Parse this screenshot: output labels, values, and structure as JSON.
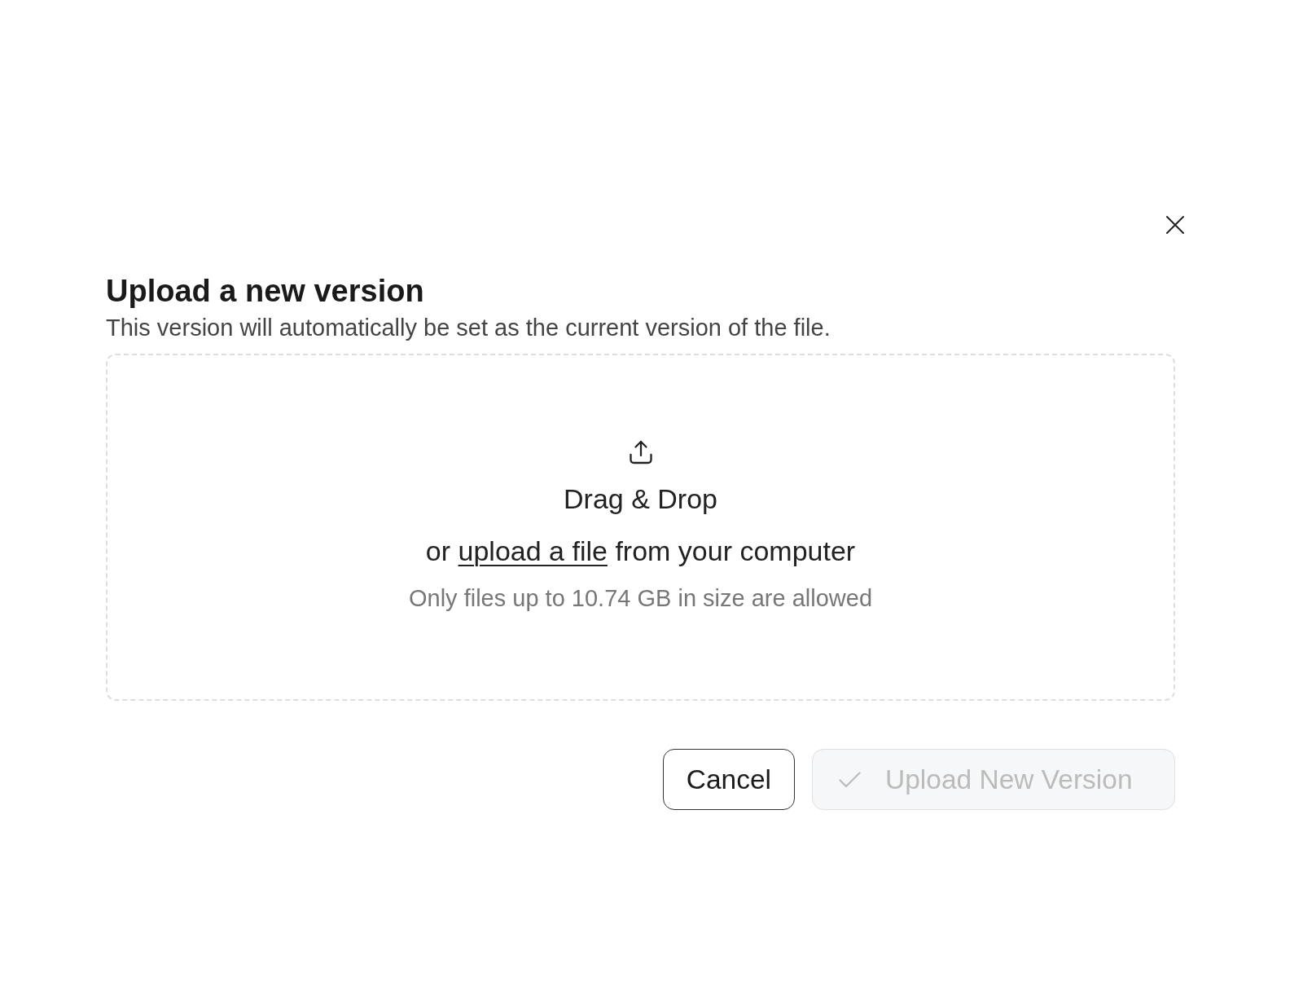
{
  "dialog": {
    "title": "Upload a new version",
    "subtitle": "This version will automatically be set as the current version of the file.",
    "dropzone": {
      "heading": "Drag & Drop",
      "instruction": {
        "prefix": "or",
        "link": "upload a file",
        "suffix": "from your computer"
      },
      "limit_note": "Only files up to 10.74 GB in size are allowed"
    },
    "buttons": [
      {
        "label": "Cancel",
        "kind": "secondary",
        "disabled": false
      },
      {
        "label": "Upload New Version",
        "kind": "primary",
        "disabled": true
      }
    ]
  }
}
